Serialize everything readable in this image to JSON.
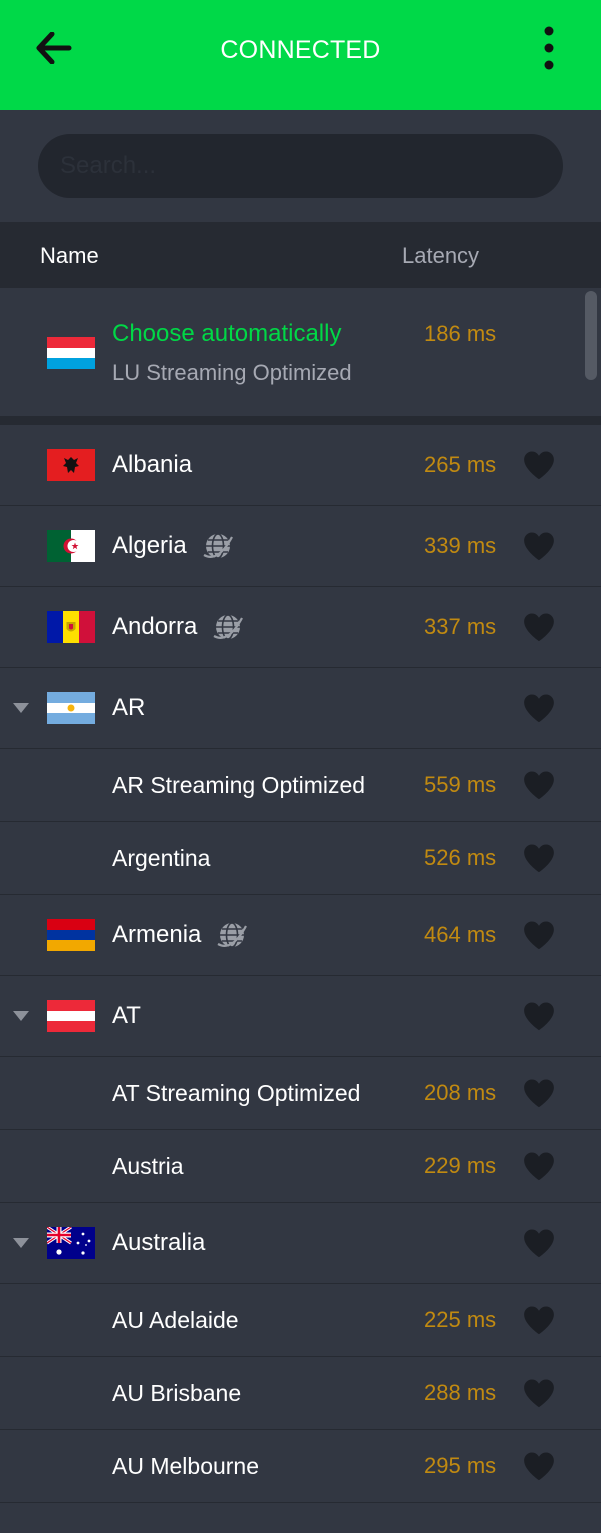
{
  "header": {
    "title": "CONNECTED",
    "back_icon": "arrow-left-icon",
    "menu_icon": "more-vertical-icon",
    "bar_color": "#00d948"
  },
  "search": {
    "placeholder": "Search...",
    "value": ""
  },
  "columns": {
    "name": "Name",
    "latency": "Latency"
  },
  "auto": {
    "title": "Choose automatically",
    "subtitle": "LU Streaming Optimized",
    "latency": "186 ms",
    "flag": "luxembourg"
  },
  "colors": {
    "accent_green": "#00d846",
    "latency_text": "#c18a11",
    "background": "#323742",
    "header_bg": "#262a32"
  },
  "servers": [
    {
      "type": "country",
      "label": "Albania",
      "latency": "265 ms",
      "flag": "albania",
      "virtual": false
    },
    {
      "type": "country",
      "label": "Algeria",
      "latency": "339 ms",
      "flag": "algeria",
      "virtual": true
    },
    {
      "type": "country",
      "label": "Andorra",
      "latency": "337 ms",
      "flag": "andorra",
      "virtual": true
    },
    {
      "type": "group",
      "label": "AR",
      "latency": "",
      "flag": "argentina",
      "virtual": false,
      "expanded": true
    },
    {
      "type": "sub",
      "label": "AR Streaming Optimized",
      "latency": "559 ms"
    },
    {
      "type": "sub",
      "label": "Argentina",
      "latency": "526 ms"
    },
    {
      "type": "country",
      "label": "Armenia",
      "latency": "464 ms",
      "flag": "armenia",
      "virtual": true
    },
    {
      "type": "group",
      "label": "AT",
      "latency": "",
      "flag": "austria",
      "virtual": false,
      "expanded": true
    },
    {
      "type": "sub",
      "label": "AT Streaming Optimized",
      "latency": "208 ms"
    },
    {
      "type": "sub",
      "label": "Austria",
      "latency": "229 ms"
    },
    {
      "type": "group",
      "label": "Australia",
      "latency": "",
      "flag": "australia",
      "virtual": false,
      "expanded": true
    },
    {
      "type": "sub",
      "label": "AU Adelaide",
      "latency": "225 ms"
    },
    {
      "type": "sub",
      "label": "AU Brisbane",
      "latency": "288 ms"
    },
    {
      "type": "sub",
      "label": "AU Melbourne",
      "latency": "295 ms"
    }
  ],
  "icons": {
    "favorite": "heart-icon",
    "virtual_location": "globe-icon",
    "expand": "caret-down-icon"
  }
}
